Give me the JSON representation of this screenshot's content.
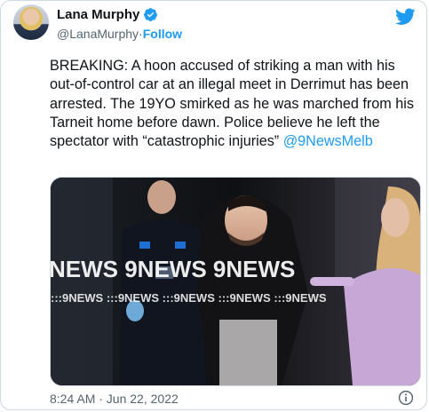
{
  "author": {
    "name": "Lana Murphy",
    "handle": "@LanaMurphy",
    "separator": " · ",
    "follow_label": "Follow"
  },
  "tweet": {
    "text": "BREAKING: A hoon accused of striking a man with his out-of-control car at an illegal meet in Derrimut has been arrested. The 19YO smirked as he was marched from his Tarneit home before dawn. Police believe he left the spectator with “catastrophic injuries” ",
    "mention": "@9NewsMelb",
    "timestamp": "8:24 AM · Jun 22, 2022"
  },
  "media": {
    "watermark_main": "NEWS 9NEWS 9NEWS",
    "watermark_small": ":::9NEWS :::9NEWS :::9NEWS :::9NEWS :::9NEWS"
  },
  "icons": {
    "verified": "verified-badge-icon",
    "brand": "twitter-bird-icon",
    "info": "info-icon"
  },
  "colors": {
    "accent": "#1d9bf0",
    "text": "#0f1419",
    "secondary": "#536471",
    "border": "#cfd9de"
  }
}
